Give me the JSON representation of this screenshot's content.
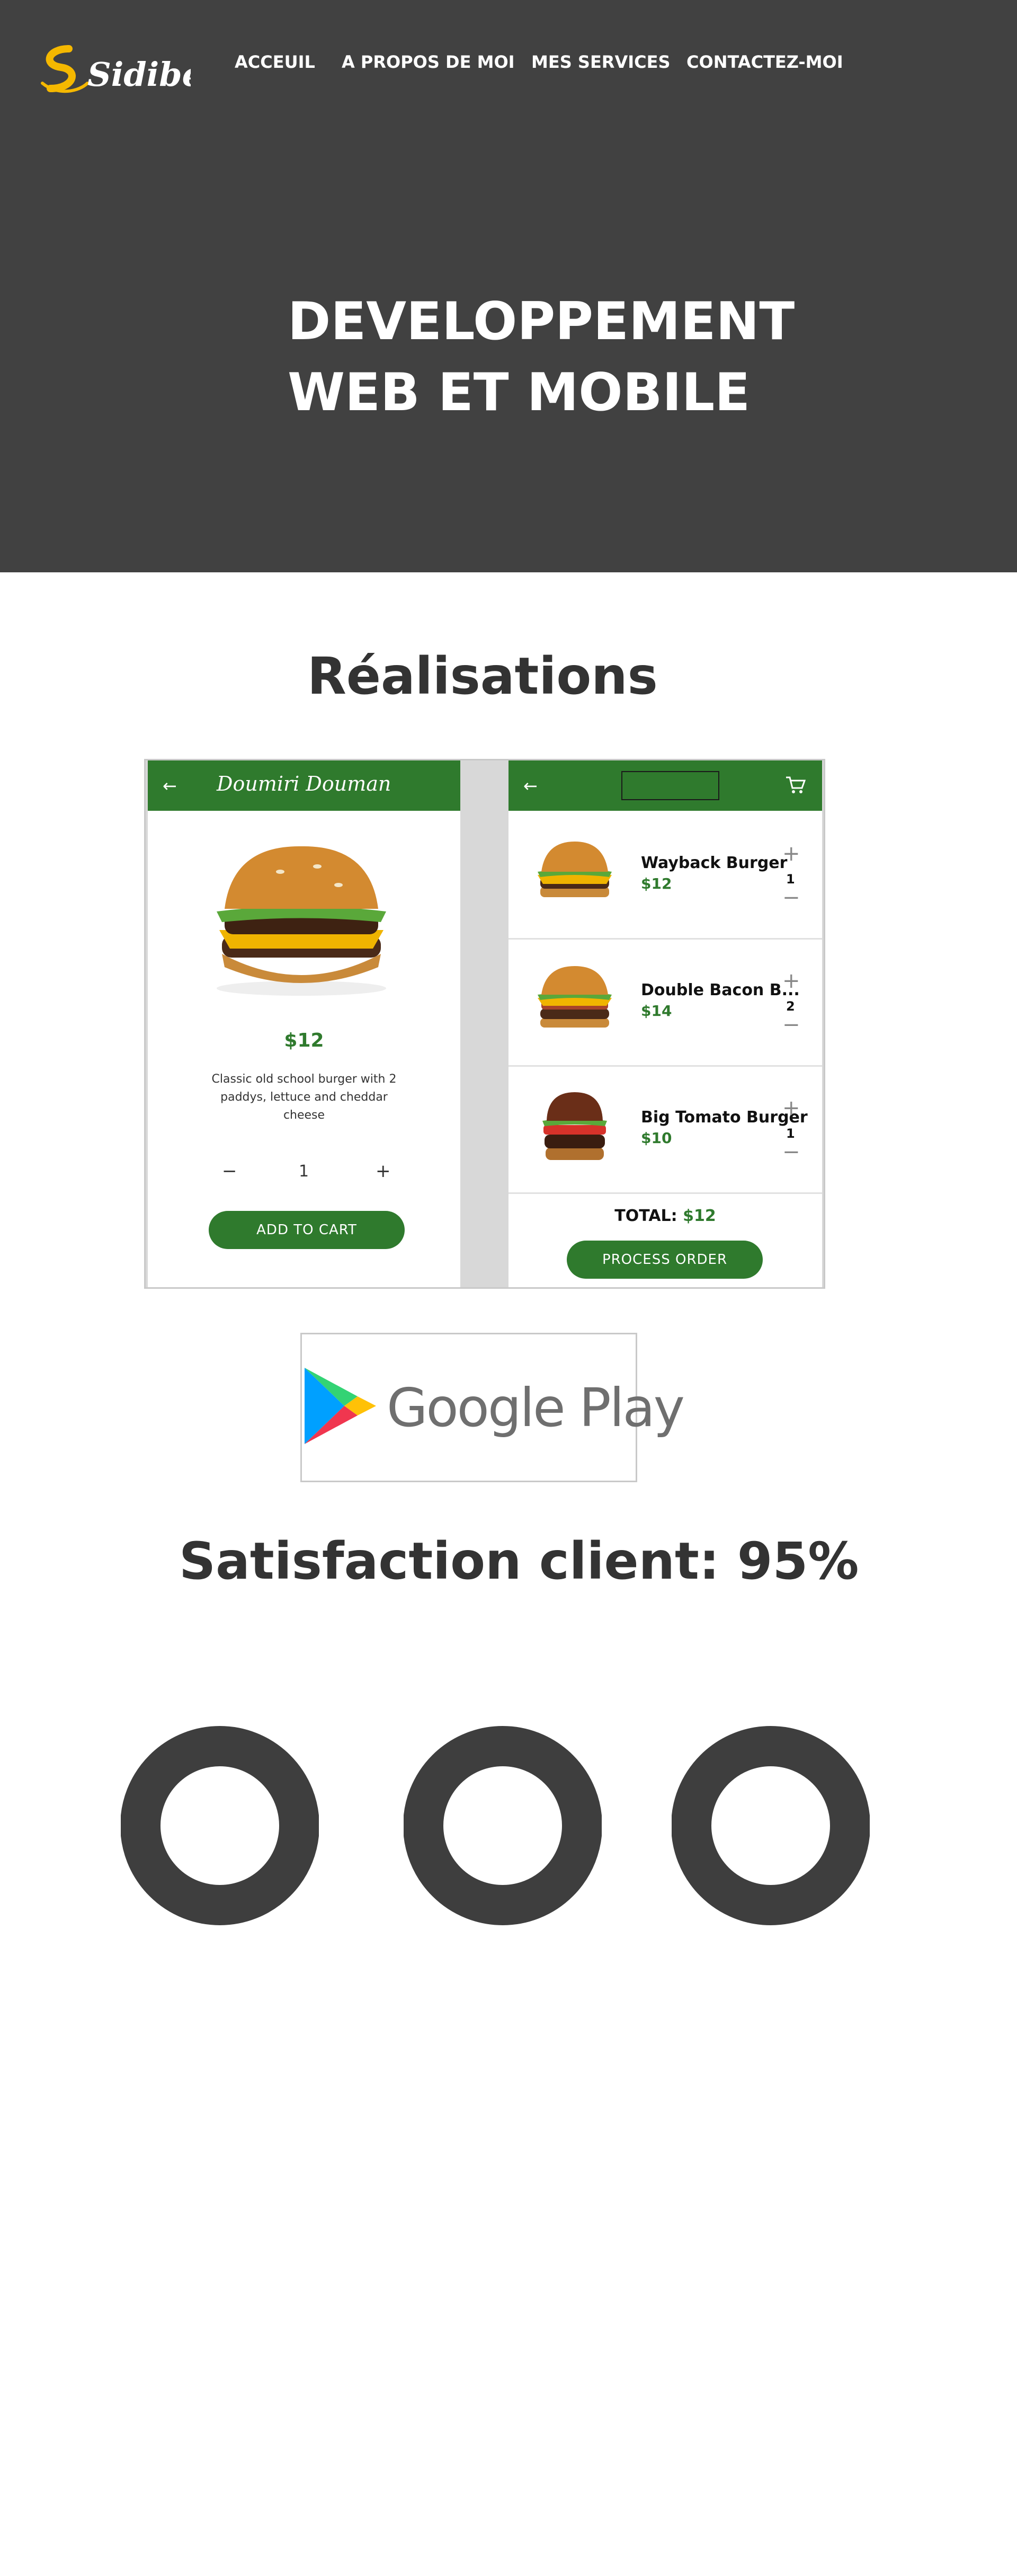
{
  "header": {
    "logo_text": "Sidibé",
    "nav": [
      {
        "label": "ACCEUIL"
      },
      {
        "label": "A PROPOS DE MOI"
      },
      {
        "label": "MES SERVICES"
      },
      {
        "label": "CONTACTEZ-MOI"
      }
    ]
  },
  "hero": {
    "title": "DEVELOPPEMENT\nWEB ET MOBILE"
  },
  "realisations": {
    "title": "Réalisations",
    "product_screen": {
      "brand": "Doumiri Douman",
      "price": "$12",
      "description": "Classic old school burger with 2 paddys, lettuce and cheddar cheese",
      "minus": "−",
      "quantity": "1",
      "plus": "+",
      "add_to_cart": "ADD TO CART"
    },
    "cart_screen": {
      "items": [
        {
          "name": "Wayback Burger",
          "price": "$12",
          "qty": "1"
        },
        {
          "name": "Double Bacon B...",
          "price": "$14",
          "qty": "2"
        },
        {
          "name": "Big Tomato Burger",
          "price": "$10",
          "qty": "1"
        }
      ],
      "total_label": "TOTAL:",
      "total_value": "$12",
      "process_order": "PROCESS ORDER"
    }
  },
  "store_badge": {
    "text": "Google Play"
  },
  "satisfaction": {
    "title": "Satisfaction client: 95%"
  },
  "colors": {
    "hero_bg": "#414141",
    "accent_green": "#2f7a2d",
    "logo_yellow": "#f5b800",
    "donut": "#3e3e3e"
  }
}
